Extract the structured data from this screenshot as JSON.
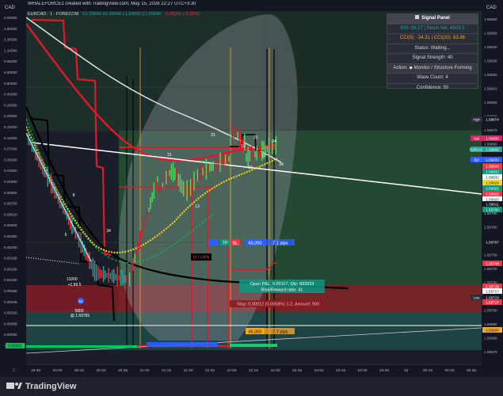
{
  "header": {
    "watermark": "WHALEFORCE1 created with TradingView.com, May 15, 2026 22:27 UTC+3:30",
    "symbol": "EURCAD · 1 · FORECOM",
    "ohlc": "O1.59846 H1.59846 L1.59830 C1.59840",
    "change": "-0.00241 (-0.15%)"
  },
  "currency_left": "CAD",
  "currency_right": "CAD",
  "signal_panel": {
    "title": "Signal Panel",
    "rsi": "RSI: 59.17 | Stoch %K: 6503.5",
    "cci": "CCI(5): -34.31 | CCI(20): 83.86",
    "status": "Status: Waiting...",
    "strength": "Signal Strength: 40",
    "action": "Action:  ◆  Monitor / Structure Forming",
    "wave_count": "Wave Count: 4",
    "confidence": "Confidence: 50"
  },
  "left_axis": {
    "ticks": [
      "2.00000",
      "1.80000",
      "1.30000",
      "1.10000",
      "0.95000",
      "0.80000",
      "0.60000",
      "0.40000",
      "0.26000",
      "0.20000",
      "0.15000",
      "0.10000",
      "0.07000",
      "0.05000",
      "0.03000",
      "0.01900",
      "0.00850",
      "0.00700",
      "0.00620",
      "0.00500",
      "0.00350",
      "0.00250",
      "0.00190",
      "0.00150",
      "0.00100",
      "0.00066",
      "0.00046",
      "0.00026",
      "0.00009",
      "0.00000",
      "-0.00001"
    ]
  },
  "right_axis": {
    "ticks": [
      "1.59960",
      "1.59950",
      "1.59940",
      "1.59930",
      "1.59920",
      "1.59910",
      "1.59900",
      "1.59890",
      "1.59870",
      "1.59860",
      "1.59850",
      "1.59840",
      "1.59820",
      "1.59800",
      "1.59790",
      "1.59780",
      "1.59760",
      "1.59750",
      "1.59740",
      "1.59730",
      "1.59720",
      "1.59700",
      "1.59690",
      "1.59680",
      "1.59670"
    ],
    "badges": [
      {
        "name": "high-badge",
        "tag": "High",
        "value": "1.59874",
        "color": "#131722"
      },
      {
        "name": "ask-badge",
        "tag": "Ask",
        "value": "1.59856",
        "color": "#e91e63"
      },
      {
        "name": "eurcad-badge",
        "tag": "EURCAD",
        "value": "1.59846",
        "color": "#26a69a"
      },
      {
        "name": "bid-badge",
        "tag": "Bid",
        "value": "1.59833",
        "color": "#2962ff"
      },
      {
        "name": "level-badge-1",
        "tag": "",
        "value": "1.59833",
        "color": "#f23645"
      },
      {
        "name": "level-badge-2",
        "tag": "",
        "value": "1.59832",
        "color": "#089981"
      },
      {
        "name": "level-badge-3",
        "tag": "",
        "value": "1.59832",
        "color": "#ffffff"
      },
      {
        "name": "level-badge-4",
        "tag": "",
        "value": "1.59829",
        "color": "#f5d90a"
      },
      {
        "name": "level-badge-5",
        "tag": "",
        "value": "1.59825",
        "color": "#089981"
      },
      {
        "name": "level-badge-6",
        "tag": "",
        "value": "1.59822",
        "color": "#f23645"
      },
      {
        "name": "level-badge-7",
        "tag": "",
        "value": "1.59820",
        "color": "#ffffff"
      },
      {
        "name": "level-badge-8",
        "tag": "",
        "value": "1.59811",
        "color": "#131722"
      },
      {
        "name": "level-badge-9",
        "tag": "",
        "value": "1.59798",
        "color": "#089981"
      },
      {
        "name": "level-badge-10",
        "tag": "",
        "value": "1.59767",
        "color": "#131722"
      },
      {
        "name": "level-badge-11",
        "tag": "",
        "value": "1.59748",
        "color": "#f23645"
      },
      {
        "name": "level-badge-12",
        "tag": "",
        "value": "1.59729",
        "color": "#f23645"
      },
      {
        "name": "level-badge-13",
        "tag": "",
        "value": "1.59727",
        "color": "#ffffff"
      },
      {
        "name": "low-badge",
        "tag": "Low",
        "value": "1.59719",
        "color": "#131722"
      },
      {
        "name": "level-badge-14",
        "tag": "",
        "value": "1.59717",
        "color": "#f23645"
      },
      {
        "name": "level-badge-15",
        "tag": "",
        "value": "1.59690",
        "color": "#f5a623"
      }
    ]
  },
  "time_axis": {
    "ticks": [
      "19:45",
      "20:00",
      "20:15",
      "20:30",
      "20:45",
      "21:00",
      "21:15",
      "21:30",
      "21:45",
      "22:00",
      "22:15",
      "22:30",
      "22:45",
      "23:00",
      "23:15",
      "23:30",
      "23:45",
      "16",
      "00:15",
      "00:30",
      "00:45"
    ],
    "left_label": "2"
  },
  "annotations": {
    "tp": "TP",
    "sl": "SL",
    "mid_box": "65,000",
    "mid_pips": "-7.1 pips",
    "bottom_box": "65,000",
    "bottom_pips": "-7.7 pips",
    "open_pl": "Open P&L: 0.00117, Qty: 833333",
    "risk_reward": "Risk/Reward ratio: 41",
    "stop": "Stop: 0.00012 (0.0058%) 1.2, Amount: 900",
    "u_turn": "U-TURN",
    "level_11000": "11000",
    "level_5": "+1.99 5",
    "level_54": "54",
    "level_5800": "5800",
    "level_1597": "@ 1.59781",
    "wave_labels": [
      "34",
      "21",
      "13",
      "8",
      "34",
      "21",
      "13",
      "34",
      "21",
      "13",
      "34",
      "5"
    ],
    "left_zero": "0.00000"
  },
  "footer": {
    "brand": "TradingView"
  },
  "colors": {
    "background": "#131722",
    "green_zone": "#2e6b3a",
    "red_zone": "#8b1c24",
    "teal_zone": "#1f4a4a",
    "yellow_line": "#f5d90a",
    "red_line": "#e0182b",
    "white_line": "#ffffff",
    "black_line": "#000000"
  }
}
